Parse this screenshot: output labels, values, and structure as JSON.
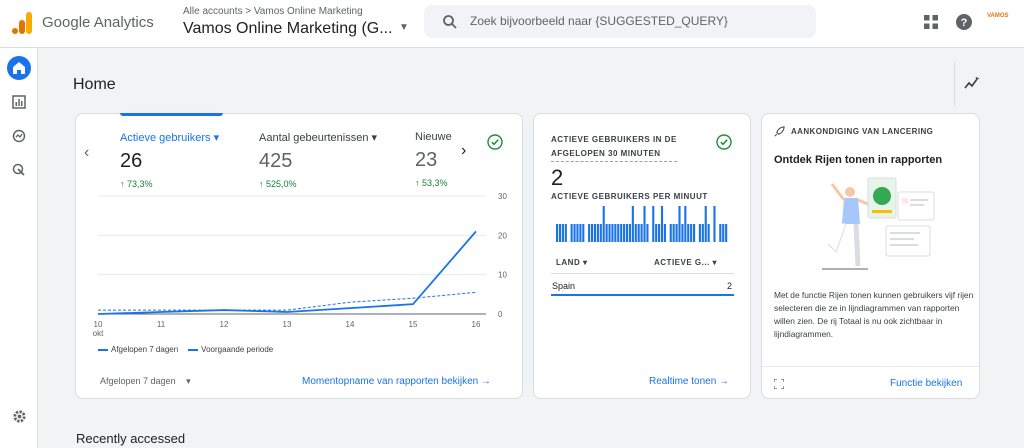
{
  "header": {
    "product_name": "Google Analytics",
    "account_breadcrumb": "Alle accounts > Vamos Online Marketing",
    "property_name": "Vamos Online Marketing (G...",
    "search_placeholder": "Zoek bijvoorbeeld naar {SUGGESTED_QUERY}",
    "avatar_text": "VAMOS"
  },
  "page": {
    "title": "Home",
    "recently_accessed": "Recently accessed"
  },
  "overview_card": {
    "metrics": [
      {
        "label": "Actieve gebruikers",
        "value": "26",
        "change": "73,3%",
        "selected": true
      },
      {
        "label": "Aantal gebeurtenissen",
        "value": "425",
        "change": "525,0%"
      },
      {
        "label": "Nieuwe gebruikers",
        "value": "23",
        "change": "53,3%"
      }
    ],
    "legend_current": "Afgelopen 7 dagen",
    "legend_previous": "Voorgaande periode",
    "period_selector": "Afgelopen 7 dagen",
    "link": "Momentopname van rapporten bekijken"
  },
  "chart_data": {
    "type": "line",
    "x": [
      "10 okt",
      "11",
      "12",
      "13",
      "14",
      "15",
      "16"
    ],
    "y_ticks": [
      "0",
      "10",
      "20",
      "30"
    ],
    "ylim": [
      0,
      30
    ],
    "series": [
      {
        "name": "Afgelopen 7 dagen",
        "values": [
          0,
          0.5,
          1,
          0.5,
          1.5,
          2.5,
          21
        ],
        "style": "solid",
        "color": "#1a73e8"
      },
      {
        "name": "Voorgaande periode",
        "values": [
          1,
          1,
          1,
          1,
          3,
          4,
          5.5
        ],
        "style": "dashed",
        "color": "#1a73e8"
      }
    ]
  },
  "realtime_card": {
    "title_line1": "ACTIEVE GEBRUIKERS IN DE",
    "title_line2": "AFGELOPEN 30 MINUTEN",
    "value": "2",
    "subtitle": "ACTIEVE GEBRUIKERS PER MINUUT",
    "bars": [
      1,
      1,
      1,
      1,
      0,
      1,
      1,
      1,
      1,
      1,
      0,
      1,
      1,
      1,
      1,
      1,
      2,
      1,
      1,
      1,
      1,
      1,
      1,
      1,
      1,
      1,
      2,
      1,
      1,
      1,
      2,
      1,
      0,
      2,
      1,
      1,
      2,
      1,
      0,
      1,
      1,
      1,
      2,
      1,
      2,
      1,
      1,
      1,
      0,
      1,
      1,
      2,
      1,
      0,
      2,
      0,
      1,
      1,
      1
    ],
    "col_country": "LAND",
    "col_users": "ACTIEVE G...",
    "rows": [
      {
        "country": "Spain",
        "users": "2"
      }
    ],
    "link": "Realtime tonen"
  },
  "announcement_card": {
    "label": "AANKONDIGING VAN LANCERING",
    "title": "Ontdek Rijen tonen in rapporten",
    "body": "Met de functie Rijen tonen kunnen gebruikers vijf rijen selecteren die ze in lijndiagrammen van rapporten willen zien. De rij Totaal is nu ook zichtbaar in lijndiagrammen.",
    "link": "Functie bekijken"
  },
  "colors": {
    "accent": "#1a73e8",
    "positive": "#188038",
    "check": "#1e8e3e"
  }
}
